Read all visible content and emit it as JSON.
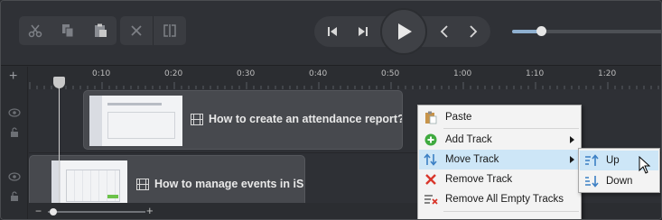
{
  "toolbar": {
    "edit_icons": [
      "scissors-icon",
      "copy-icon",
      "paste-icon",
      "delete-icon",
      "split-icon"
    ],
    "playback_icons": [
      "skip-back-icon",
      "skip-forward-icon",
      "play-icon",
      "previous-icon",
      "next-icon"
    ],
    "zoom_level": 0.2
  },
  "ruler": {
    "ticks": [
      "0:10",
      "0:20",
      "0:30",
      "0:40",
      "0:50",
      "1:00",
      "1:10",
      "1:20"
    ]
  },
  "timeline": {
    "add_track_glyph": "+",
    "clips": [
      {
        "title": "How to create an attendance report?"
      },
      {
        "title": "How to manage events in iSp"
      }
    ],
    "zoom_minus": "−",
    "zoom_plus": "+"
  },
  "context_menu": {
    "items": [
      {
        "label": "Paste",
        "icon": "clipboard-icon"
      },
      {
        "label": "Add Track",
        "icon": "add-circle-icon",
        "submenu": true
      },
      {
        "label": "Move Track",
        "icon": "move-arrows-icon",
        "submenu": true,
        "highlighted": true
      },
      {
        "label": "Remove Track",
        "icon": "red-x-icon"
      },
      {
        "label": "Remove All Empty Tracks",
        "icon": "remove-lines-icon"
      }
    ],
    "submenu": [
      {
        "label": "Up",
        "icon": "sort-up-icon",
        "highlighted": true
      },
      {
        "label": "Down",
        "icon": "sort-down-icon"
      }
    ]
  },
  "colors": {
    "accent": "#8fb0d0",
    "menu_highlight": "#cde6f7",
    "background": "#2b2d31"
  }
}
